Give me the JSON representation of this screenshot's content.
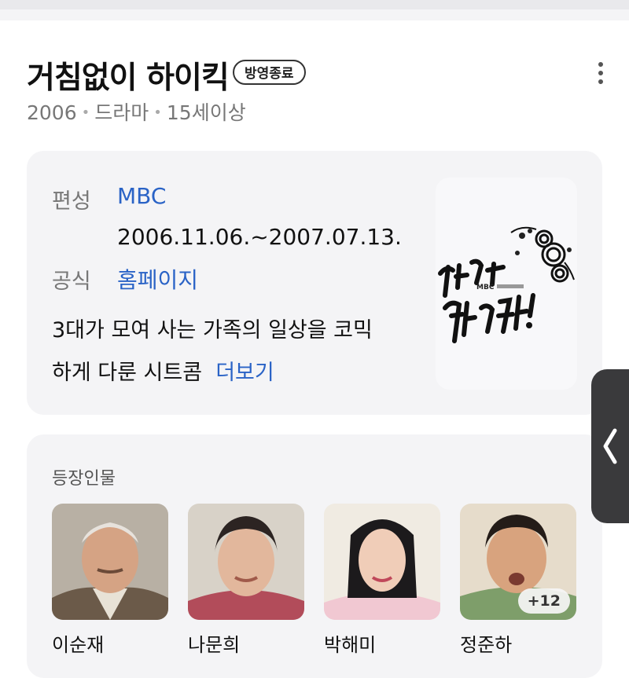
{
  "header": {
    "title": "거침없이 하이킥",
    "status_badge": "방영종료",
    "meta": {
      "year": "2006",
      "genre": "드라마",
      "rating": "15세이상"
    }
  },
  "info": {
    "broadcast_label": "편성",
    "broadcast_value": "MBC",
    "dates": "2006.11.06.~2007.07.13.",
    "official_label": "공식",
    "official_value": "홈페이지",
    "description_line1": "3대가 모여 사는 가족의 일상을 코믹",
    "description_line2": "하게 다룬 시트콤",
    "more_link": "더보기"
  },
  "poster": {
    "icon": "show-poster-logo",
    "mark_text": "MBC"
  },
  "characters": {
    "section_title": "등장인물",
    "items": [
      {
        "name": "이순재"
      },
      {
        "name": "나문희"
      },
      {
        "name": "박해미"
      },
      {
        "name": "정준하"
      }
    ],
    "more_count": "+12"
  },
  "icons": {
    "more": "more-vertical-icon",
    "side": "chevron-left-icon"
  },
  "colors": {
    "link": "#2a63c6",
    "card_bg": "#f4f4f6",
    "side_tab": "#3a3a3c"
  }
}
